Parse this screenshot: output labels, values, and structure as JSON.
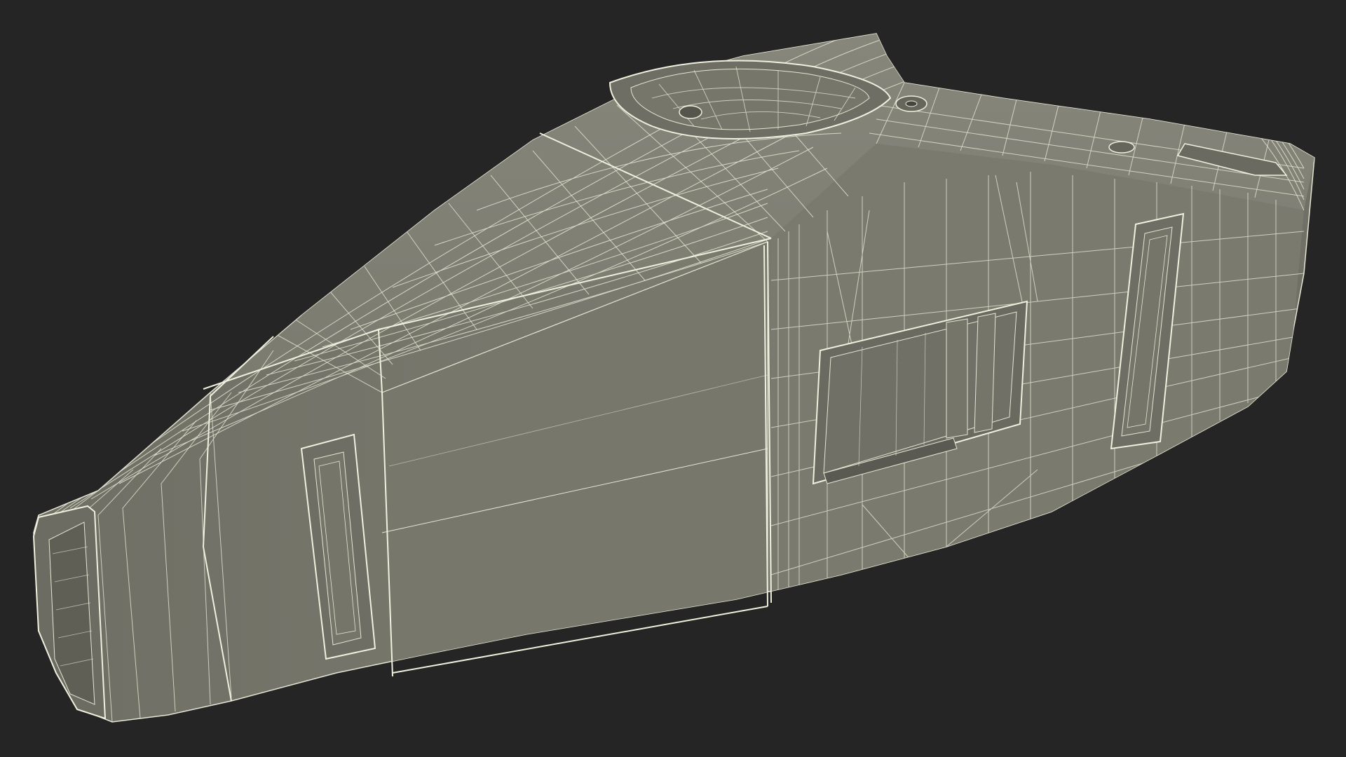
{
  "scene": {
    "background_color": "#252525",
    "surface_color": "#7b7b70",
    "surface_dark_color": "#65655b",
    "surface_light_color": "#88887d",
    "wire_color": "#e6e6d4",
    "object": "wireframe-handheld-vacuum-body-icon"
  }
}
